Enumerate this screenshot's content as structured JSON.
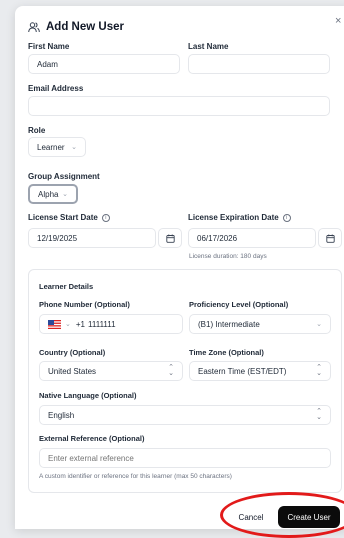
{
  "modal": {
    "title": "Add New User",
    "close_label": "×"
  },
  "form": {
    "first_name": {
      "label": "First Name",
      "value": "Adam"
    },
    "last_name": {
      "label": "Last Name",
      "value": ""
    },
    "email": {
      "label": "Email Address",
      "value": ""
    },
    "role": {
      "label": "Role",
      "value": "Learner"
    },
    "group": {
      "label": "Group Assignment",
      "value": "Alpha"
    },
    "license_start": {
      "label": "License Start Date",
      "value": "12/19/2025"
    },
    "license_expiration": {
      "label": "License Expiration Date",
      "value": "06/17/2026"
    },
    "license_duration": "License duration: 180 days"
  },
  "learner_details": {
    "heading": "Learner Details",
    "phone": {
      "label": "Phone Number (Optional)",
      "country_code": "+1",
      "value": "1111111"
    },
    "proficiency": {
      "label": "Proficiency Level (Optional)",
      "value": "(B1) Intermediate"
    },
    "country": {
      "label": "Country (Optional)",
      "value": "United States"
    },
    "timezone": {
      "label": "Time Zone (Optional)",
      "value": "Eastern Time (EST/EDT)"
    },
    "native_language": {
      "label": "Native Language (Optional)",
      "value": "English"
    },
    "external_ref": {
      "label": "External Reference (Optional)",
      "placeholder": "Enter external reference",
      "hint": "A custom identifier or reference for this learner (max 50 characters)"
    }
  },
  "actions": {
    "cancel": "Cancel",
    "create": "Create User"
  },
  "icons": {
    "info": "i"
  }
}
